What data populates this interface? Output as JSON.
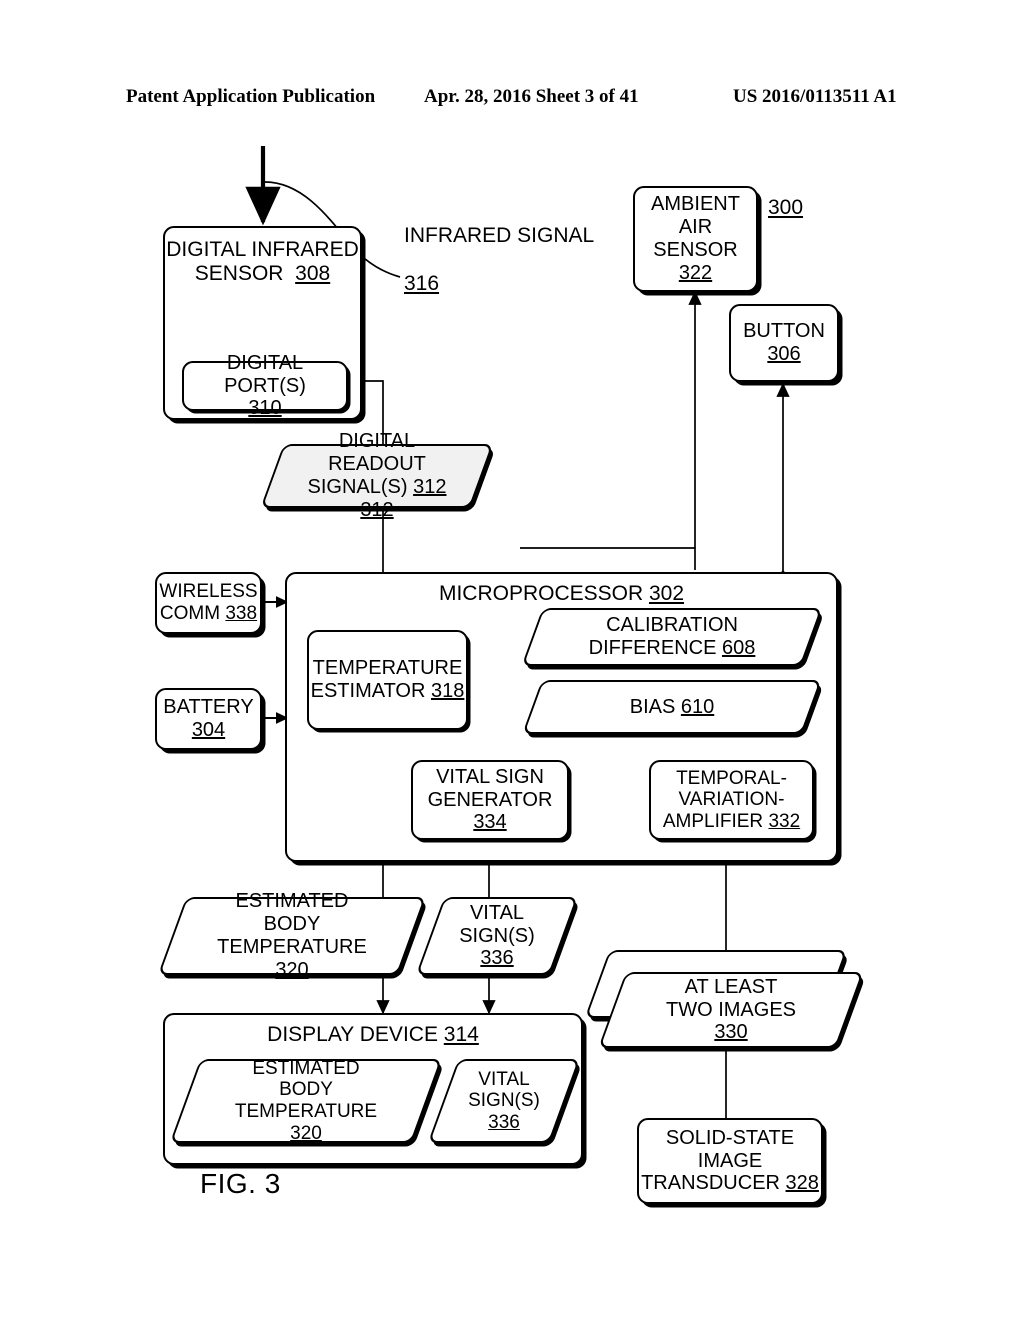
{
  "header": {
    "left": "Patent Application Publication",
    "middle": "Apr. 28, 2016  Sheet 3 of 41",
    "right": "US 2016/0113511 A1"
  },
  "figure": {
    "caption": "FIG. 3",
    "system_ref": "300",
    "nodes": {
      "digital_infrared_sensor": {
        "label": "DIGITAL INFRARED SENSOR",
        "ref": "308"
      },
      "digital_ports": {
        "label": "DIGITAL PORT(S)",
        "ref": "310"
      },
      "infrared_signal": {
        "label": "INFRARED SIGNAL",
        "ref": "316"
      },
      "ambient_air_sensor": {
        "label": "AMBIENT AIR SENSOR",
        "ref": "322"
      },
      "button": {
        "label": "BUTTON",
        "ref": "306"
      },
      "digital_readout_signals": {
        "label": "DIGITAL READOUT SIGNAL(S)",
        "ref": "312"
      },
      "microprocessor": {
        "label": "MICROPROCESSOR",
        "ref": "302"
      },
      "wireless_comm": {
        "label": "WIRELESS COMM",
        "ref": "338"
      },
      "battery": {
        "label": "BATTERY",
        "ref": "304"
      },
      "temperature_estimator": {
        "label": "TEMPERATURE ESTIMATOR",
        "ref": "318"
      },
      "calibration_difference": {
        "label": "CALIBRATION DIFFERENCE",
        "ref": "608"
      },
      "bias": {
        "label": "BIAS",
        "ref": "610"
      },
      "vital_sign_generator": {
        "label": "VITAL SIGN GENERATOR",
        "ref": "334"
      },
      "temporal_variation_amplifier": {
        "label": "TEMPORAL- VARIATION- AMPLIFIER",
        "ref": "332"
      },
      "estimated_body_temperature": {
        "label": "ESTIMATED BODY TEMPERATURE",
        "ref": "320"
      },
      "vital_signs": {
        "label": "VITAL SIGN(S)",
        "ref": "336"
      },
      "at_least_two_images": {
        "label": "AT LEAST TWO IMAGES",
        "ref": "330"
      },
      "solid_state_image_transducer": {
        "label": "SOLID-STATE IMAGE TRANSDUCER",
        "ref": "328"
      },
      "display_device": {
        "label": "DISPLAY DEVICE",
        "ref": "314"
      },
      "display_estimated_body_temperature": {
        "label": "ESTIMATED BODY TEMPERATURE",
        "ref": "320"
      },
      "display_vital_signs": {
        "label": "VITAL SIGN(S)",
        "ref": "336"
      }
    }
  }
}
